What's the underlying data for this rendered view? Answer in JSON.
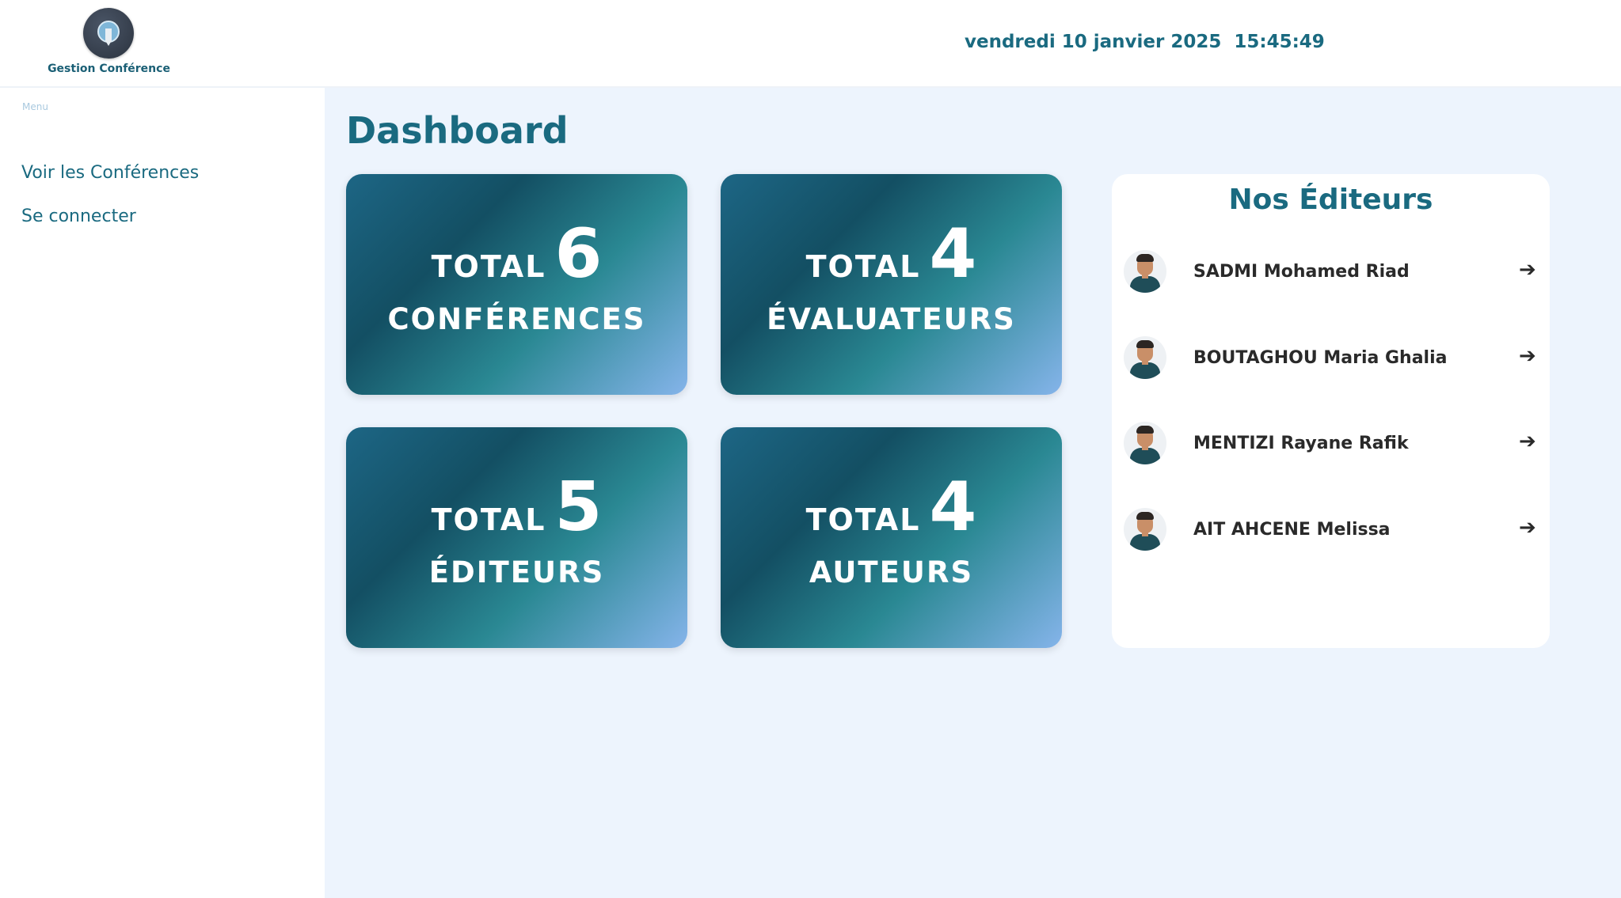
{
  "header": {
    "app_name": "Gestion Conférence",
    "datetime": "vendredi 10 janvier 2025  15:45:49",
    "logo_icon": "conference-logo-icon"
  },
  "sidebar": {
    "menu_label": "Menu",
    "items": [
      {
        "label": "Voir les Conférences"
      },
      {
        "label": "Se connecter"
      }
    ]
  },
  "main": {
    "title": "Dashboard",
    "cards": [
      {
        "total_label": "TOTAL",
        "value": "6",
        "subject": "CONFÉRENCES"
      },
      {
        "total_label": "TOTAL",
        "value": "4",
        "subject": "ÉVALUATEURS"
      },
      {
        "total_label": "TOTAL",
        "value": "5",
        "subject": "ÉDITEURS"
      },
      {
        "total_label": "TOTAL",
        "value": "4",
        "subject": "AUTEURS"
      }
    ],
    "editors_panel": {
      "title": "Nos Éditeurs",
      "arrow_icon": "arrow-right-icon",
      "editors": [
        {
          "name": "SADMI Mohamed Riad"
        },
        {
          "name": "BOUTAGHOU Maria Ghalia"
        },
        {
          "name": "MENTIZI Rayane Rafik"
        },
        {
          "name": "AIT AHCENE Melissa"
        }
      ]
    }
  },
  "colors": {
    "accent": "#1a6a80",
    "background": "#edf4fd",
    "card_gradient_start": "#1d6685",
    "card_gradient_end": "#85b4ea"
  }
}
